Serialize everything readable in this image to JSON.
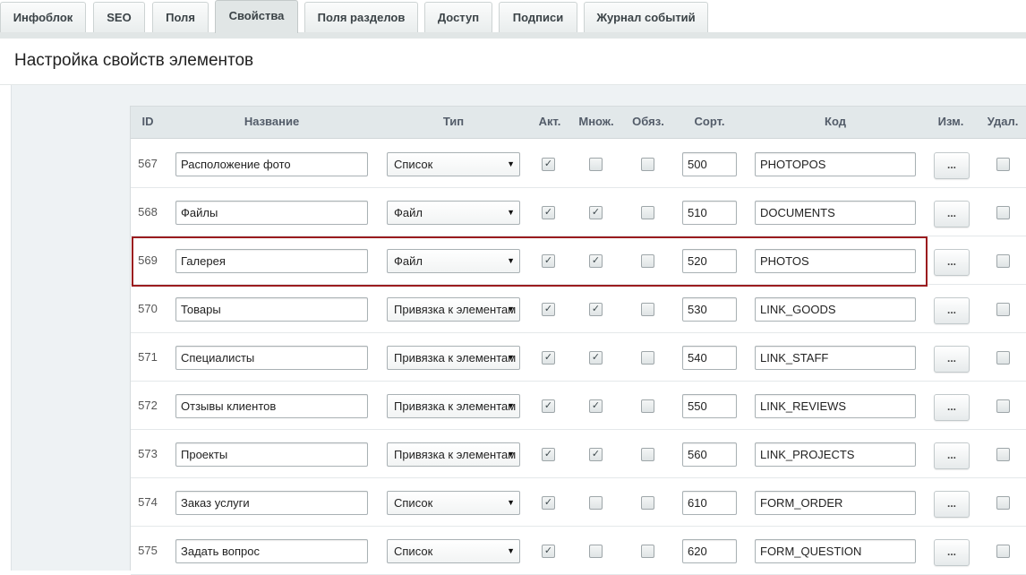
{
  "tabs": [
    {
      "label": "Инфоблок"
    },
    {
      "label": "SEO"
    },
    {
      "label": "Поля"
    },
    {
      "label": "Свойства"
    },
    {
      "label": "Поля разделов"
    },
    {
      "label": "Доступ"
    },
    {
      "label": "Подписи"
    },
    {
      "label": "Журнал событий"
    }
  ],
  "page": {
    "title": "Настройка свойств элементов"
  },
  "table": {
    "columns": {
      "id": "ID",
      "name": "Название",
      "type": "Тип",
      "active": "Акт.",
      "multiple": "Множ.",
      "required": "Обяз.",
      "sort": "Сорт.",
      "code": "Код",
      "edit": "Изм.",
      "delete": "Удал."
    },
    "edit_button_label": "...",
    "rows": [
      {
        "id": "567",
        "name": "Расположение фото",
        "type": "Список",
        "active": true,
        "multiple": false,
        "required": false,
        "sort": "500",
        "code": "PHOTOPOS"
      },
      {
        "id": "568",
        "name": "Файлы",
        "type": "Файл",
        "active": true,
        "multiple": true,
        "required": false,
        "sort": "510",
        "code": "DOCUMENTS"
      },
      {
        "id": "569",
        "name": "Галерея",
        "type": "Файл",
        "active": true,
        "multiple": true,
        "required": false,
        "sort": "520",
        "code": "PHOTOS",
        "highlighted": true
      },
      {
        "id": "570",
        "name": "Товары",
        "type": "Привязка к элементам",
        "active": true,
        "multiple": true,
        "required": false,
        "sort": "530",
        "code": "LINK_GOODS"
      },
      {
        "id": "571",
        "name": "Специалисты",
        "type": "Привязка к элементам",
        "active": true,
        "multiple": true,
        "required": false,
        "sort": "540",
        "code": "LINK_STAFF"
      },
      {
        "id": "572",
        "name": "Отзывы клиентов",
        "type": "Привязка к элементам",
        "active": true,
        "multiple": true,
        "required": false,
        "sort": "550",
        "code": "LINK_REVIEWS"
      },
      {
        "id": "573",
        "name": "Проекты",
        "type": "Привязка к элементам",
        "active": true,
        "multiple": true,
        "required": false,
        "sort": "560",
        "code": "LINK_PROJECTS"
      },
      {
        "id": "574",
        "name": "Заказ услуги",
        "type": "Список",
        "active": true,
        "multiple": false,
        "required": false,
        "sort": "610",
        "code": "FORM_ORDER"
      },
      {
        "id": "575",
        "name": "Задать вопрос",
        "type": "Список",
        "active": true,
        "multiple": false,
        "required": false,
        "sort": "620",
        "code": "FORM_QUESTION"
      }
    ]
  }
}
